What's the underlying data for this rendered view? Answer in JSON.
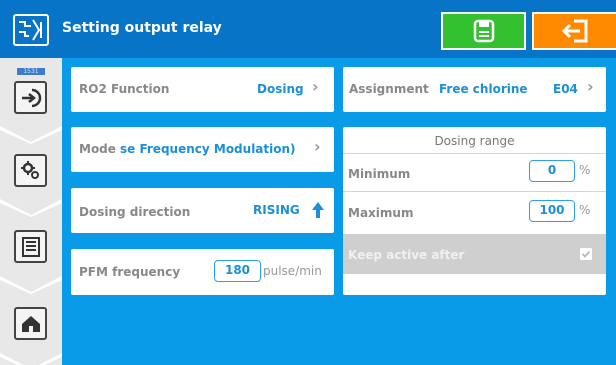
{
  "header": {
    "title": "Setting output relay",
    "save_icon": "save-icon",
    "exit_icon": "exit-icon",
    "colors": {
      "bar": "#0774c8",
      "save": "#33c12f",
      "exit": "#ff8a00"
    }
  },
  "sidebar": {
    "code": "1531",
    "items": [
      {
        "icon": "login-icon"
      },
      {
        "icon": "settings-gear-icon"
      },
      {
        "icon": "menu-list-icon"
      },
      {
        "icon": "home-icon"
      }
    ]
  },
  "left": {
    "function": {
      "label": "RO2 Function",
      "value": "Dosing"
    },
    "mode": {
      "label": "Mode",
      "value": "se Frequency Modulation)"
    },
    "direction": {
      "label": "Dosing direction",
      "value": "RISING"
    },
    "pfm": {
      "label": "PFM frequency",
      "value": "180",
      "unit": "pulse/min"
    }
  },
  "right": {
    "assignment": {
      "label": "Assignment",
      "value": "Free chlorine",
      "code": "E04"
    },
    "range": {
      "title": "Dosing range",
      "min_label": "Minimum",
      "min_value": "0",
      "min_unit": "%",
      "max_label": "Maximum",
      "max_value": "100",
      "max_unit": "%",
      "keep_label": "Keep active after",
      "keep_checked": true
    }
  }
}
